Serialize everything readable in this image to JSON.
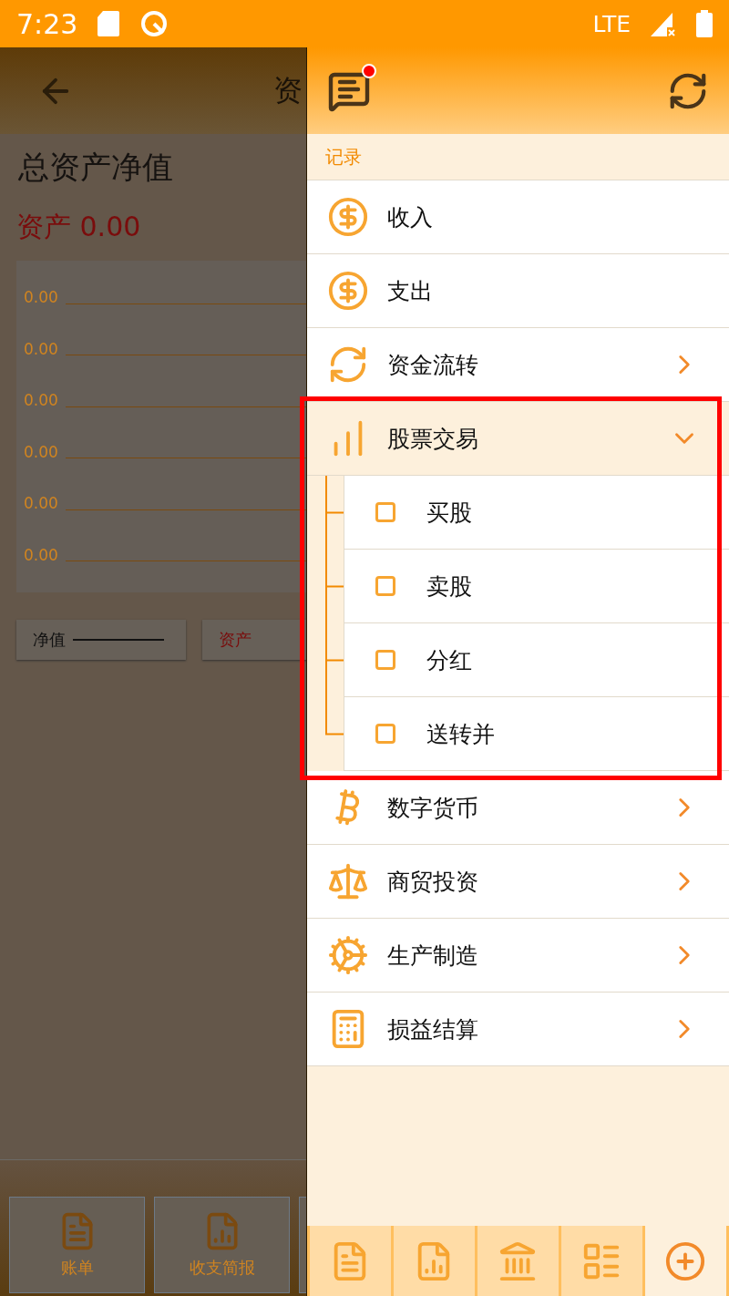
{
  "status_bar": {
    "time": "7:23",
    "network": "LTE"
  },
  "background_page": {
    "title": "资",
    "heading": "总资产净值",
    "asset_summary": "资产 0.00",
    "chart_axis_labels": [
      "0.00",
      "0.00",
      "0.00",
      "0.00",
      "0.00",
      "0.00"
    ],
    "legend": [
      {
        "label": "净值",
        "kind": "line",
        "color": "#111111"
      },
      {
        "label": "资产",
        "kind": "text",
        "color": "#7a0c0c"
      }
    ],
    "bottom_tabs": [
      {
        "label": "账单"
      },
      {
        "label": "收支简报"
      }
    ]
  },
  "drawer": {
    "notification_badge": true,
    "section": "记录",
    "menu": [
      {
        "label": "收入",
        "kind": "action"
      },
      {
        "label": "支出",
        "kind": "action"
      },
      {
        "label": "资金流转",
        "kind": "group",
        "expanded": false
      },
      {
        "label": "股票交易",
        "kind": "group",
        "expanded": true,
        "highlighted": true,
        "children": [
          {
            "label": "买股",
            "checked": false
          },
          {
            "label": "卖股",
            "checked": false
          },
          {
            "label": "分红",
            "checked": false
          },
          {
            "label": "送转并",
            "checked": false
          }
        ]
      },
      {
        "label": "数字货币",
        "kind": "group",
        "expanded": false
      },
      {
        "label": "商贸投资",
        "kind": "group",
        "expanded": false
      },
      {
        "label": "生产制造",
        "kind": "group",
        "expanded": false
      },
      {
        "label": "损益结算",
        "kind": "group",
        "expanded": false
      }
    ],
    "bottom_tabs": [
      {
        "selected": false
      },
      {
        "selected": false
      },
      {
        "selected": false
      },
      {
        "selected": false
      },
      {
        "selected": true
      }
    ]
  }
}
